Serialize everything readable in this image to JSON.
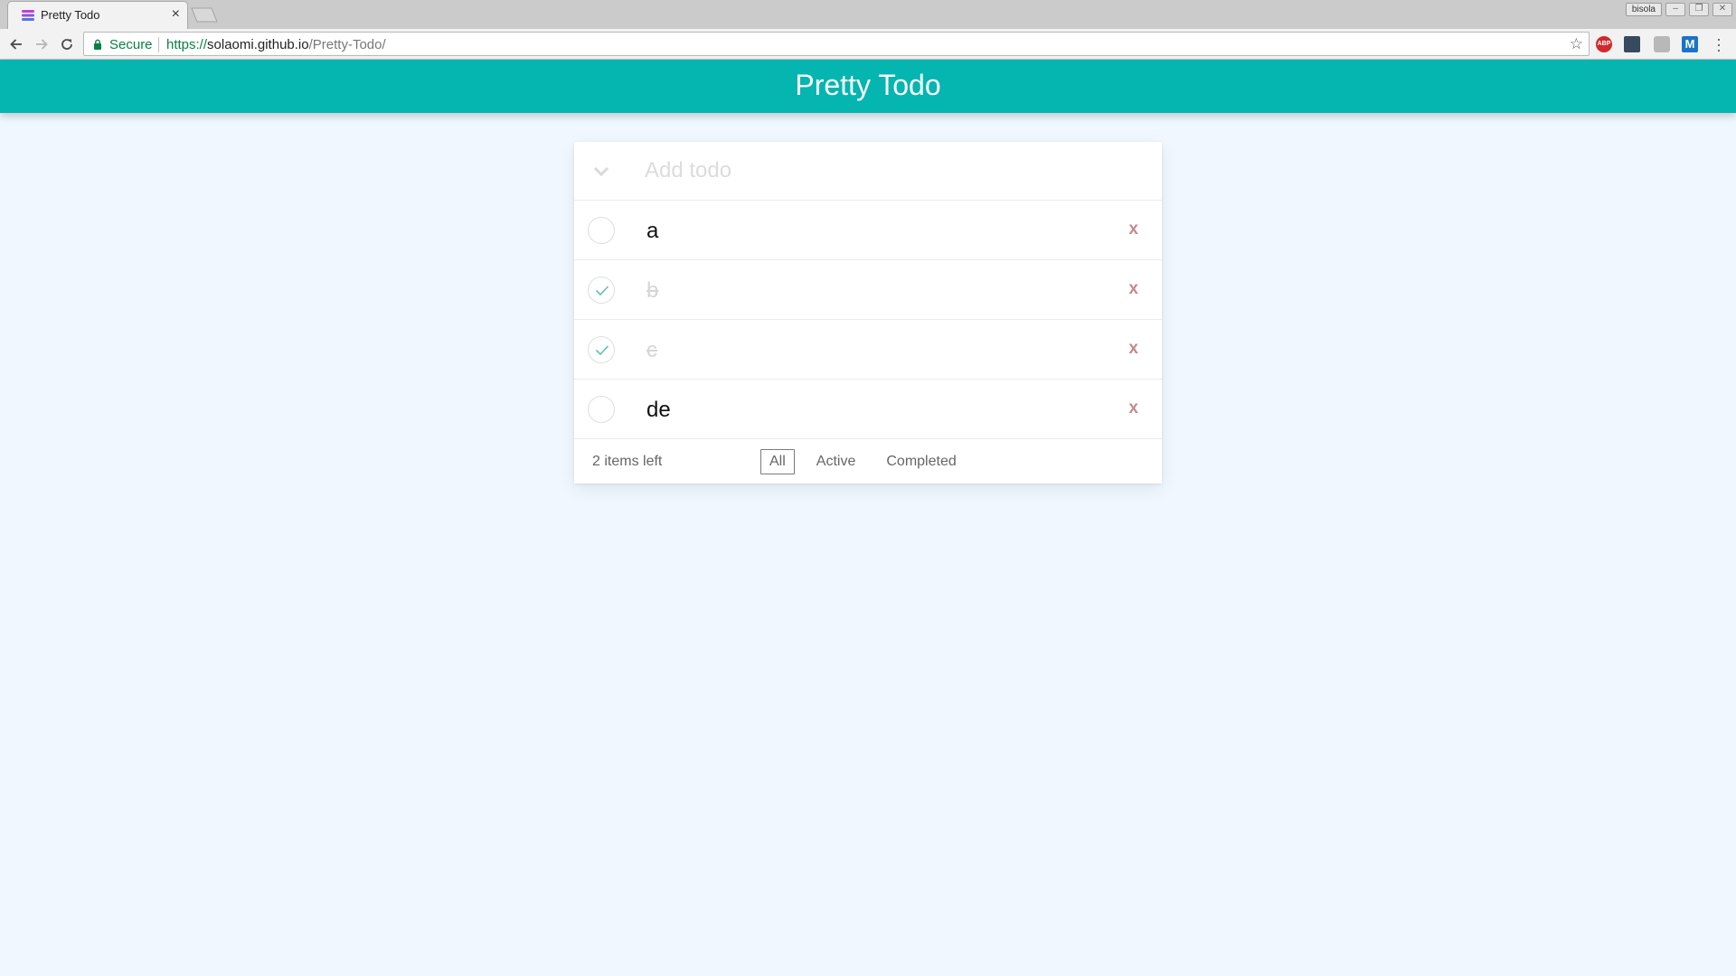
{
  "browser": {
    "tab_title": "Pretty Todo",
    "tab_close": "×",
    "profile_name": "bisola",
    "secure_label": "Secure",
    "url_scheme": "https://",
    "url_host": "solaomi.github.io",
    "url_path": "/Pretty-Todo/",
    "extensions": [
      "adblock-plus-icon",
      "dark-extension-icon",
      "printer-extension-icon",
      "m-extension-icon"
    ],
    "abp_label": "ABP",
    "m_label": "M"
  },
  "app": {
    "title": "Pretty Todo",
    "header_color": "#04b5b0",
    "background_color": "#f0f7ff",
    "add_placeholder": "Add todo",
    "todos": [
      {
        "text": "a",
        "completed": false
      },
      {
        "text": "b",
        "completed": true
      },
      {
        "text": "c",
        "completed": true
      },
      {
        "text": "de",
        "completed": false
      }
    ],
    "delete_label": "x",
    "items_left": "2 items left",
    "filters": [
      {
        "label": "All",
        "selected": true
      },
      {
        "label": "Active",
        "selected": false
      },
      {
        "label": "Completed",
        "selected": false
      }
    ]
  }
}
